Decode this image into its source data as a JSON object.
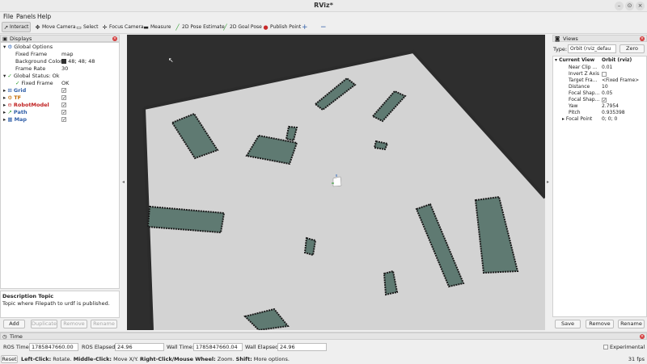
{
  "window": {
    "title": "RViz*"
  },
  "menu": {
    "file": "File",
    "panels": "Panels",
    "help": "Help"
  },
  "toolbar": {
    "interact": "Interact",
    "move_camera": "Move Camera",
    "select": "Select",
    "focus_camera": "Focus Camera",
    "measure": "Measure",
    "pose_estimate": "2D Pose Estimate",
    "goal_pose": "2D Goal Pose",
    "publish_point": "Publish Point",
    "add_tool": "+",
    "remove_tool": "−"
  },
  "displays": {
    "title": "Displays",
    "global_options": "Global Options",
    "fixed_frame_label": "Fixed Frame",
    "fixed_frame_value": "map",
    "background_color_label": "Background Color",
    "background_color_value": "48; 48; 48",
    "frame_rate_label": "Frame Rate",
    "frame_rate_value": "30",
    "global_status": "Global Status: Ok",
    "fixed_frame_status_label": "Fixed Frame",
    "fixed_frame_status_value": "OK",
    "items": [
      {
        "name": "Grid",
        "color": "#2f5ea8",
        "checked": "✓"
      },
      {
        "name": "TF",
        "color": "#c46a00",
        "checked": "✓"
      },
      {
        "name": "RobotModel",
        "color": "#c02020",
        "checked": "✓"
      },
      {
        "name": "Path",
        "color": "#2f5ea8",
        "checked": "✓"
      },
      {
        "name": "Map",
        "color": "#2f5ea8",
        "checked": "✓"
      }
    ],
    "description_title": "Description Topic",
    "description_text": "Topic where Filepath to urdf is published.",
    "buttons": {
      "add": "Add",
      "duplicate": "Duplicate",
      "remove": "Remove",
      "rename": "Rename"
    }
  },
  "views": {
    "title": "Views",
    "type_label": "Type:",
    "type_value": "Orbit (rviz_defau",
    "zero": "Zero",
    "current_view_label": "Current View",
    "current_view_value": "Orbit (rviz)",
    "rows": [
      {
        "label": "Near Clip ...",
        "value": "0.01"
      },
      {
        "label": "Invert Z Axis",
        "value": ""
      },
      {
        "label": "Target Fra...",
        "value": "<Fixed Frame>"
      },
      {
        "label": "Distance",
        "value": "10"
      },
      {
        "label": "Focal Shap...",
        "value": "0.05"
      },
      {
        "label": "Focal Shap...",
        "value": "✓"
      },
      {
        "label": "Yaw",
        "value": "2.7954"
      },
      {
        "label": "Pitch",
        "value": "0.935398"
      },
      {
        "label": "Focal Point",
        "value": "0; 0; 0"
      }
    ],
    "buttons": {
      "save": "Save",
      "remove": "Remove",
      "rename": "Rename"
    }
  },
  "time": {
    "title": "Time",
    "ros_time_label": "ROS Time:",
    "ros_time_value": "1785847660.00",
    "ros_elapsed_label": "ROS Elapsed:",
    "ros_elapsed_value": "24.96",
    "wall_time_label": "Wall Time:",
    "wall_time_value": "1785847660.04",
    "wall_elapsed_label": "Wall Elapsed:",
    "wall_elapsed_value": "24.96",
    "experimental": "Experimental"
  },
  "status": {
    "reset": "Reset",
    "left_click": "Left-Click:",
    "left_click_desc": " Rotate.",
    "middle_click": "Middle-Click:",
    "middle_click_desc": " Move X/Y.",
    "right_click": "Right-Click/Mouse Wheel:",
    "right_click_desc": " Zoom.",
    "shift": "Shift:",
    "shift_desc": " More options.",
    "fps": "31 fps"
  },
  "colors": {
    "map_free": "#d3d3d3",
    "obstacle": "#5f7a72",
    "background": "#2e2e2e"
  }
}
